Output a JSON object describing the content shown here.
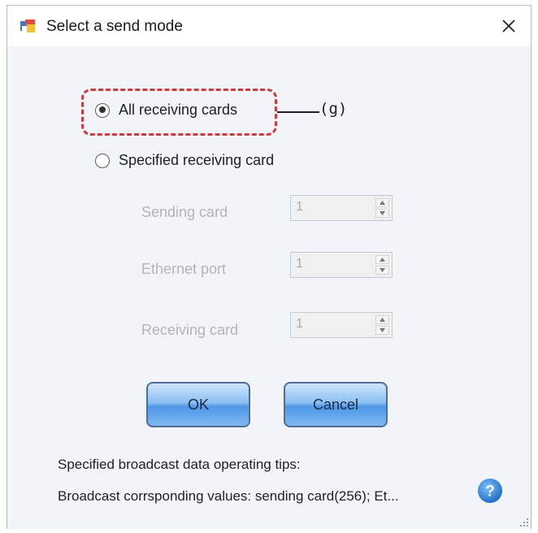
{
  "window": {
    "title": "Select a send mode"
  },
  "modes": {
    "all_label": "All receiving cards",
    "specified_label": "Specified receiving card",
    "selected": "all"
  },
  "callout": {
    "label": "(g)"
  },
  "fields": [
    {
      "label": "Sending card",
      "value": "1"
    },
    {
      "label": "Ethernet port",
      "value": "1"
    },
    {
      "label": "Receiving card",
      "value": "1"
    }
  ],
  "buttons": {
    "ok_label": "OK",
    "cancel_label": "Cancel"
  },
  "tips": {
    "heading": "Specified broadcast data operating tips:",
    "detail": "Broadcast corrsponding values: sending card(256); Et..."
  },
  "colors": {
    "highlight": "#d03a3a",
    "button_blue": "#4f97e7",
    "help_blue": "#2f86d8"
  },
  "icons": {
    "app": "app-window-icon",
    "close": "close-icon",
    "help": "help-icon"
  }
}
